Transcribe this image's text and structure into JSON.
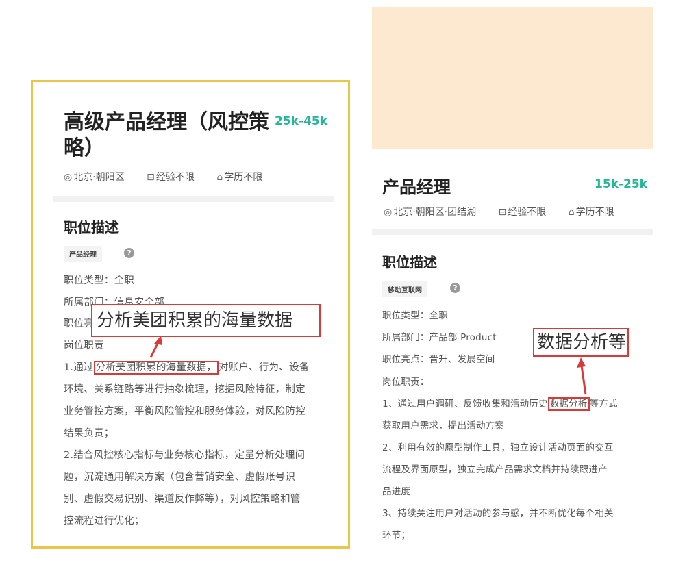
{
  "left": {
    "title": "高级产品经理（风控策略）",
    "salary": "25k-45k",
    "location": "北京·朝阳区",
    "experience": "经验不限",
    "education": "学历不限",
    "section_title": "职位描述",
    "tag": "产品经理",
    "help": "?",
    "lines": {
      "type": "职位类型：全职",
      "dept": "所属部门：信息安全部",
      "highlights_prefix": "职位亮",
      "duties": "岗位职责",
      "l1_a": "1.通过",
      "l1_hl": "分析美团积累的海量数据，",
      "l1_b": "对账户、行为、设备",
      "l2": "环境、关系链路等进行抽象梳理，挖掘风险特征，制定",
      "l3": "业务管控方案，平衡风险管控和服务体验，对风险防控",
      "l4": "结果负责；",
      "l5": "2.结合风控核心指标与业务核心指标，定量分析处理问",
      "l6": "题，沉淀通用解决方案（包含营销安全、虚假账号识",
      "l7": "别、虚假交易识别、渠道反作弊等），对风控策略和管",
      "l8": "控流程进行优化；"
    },
    "callout": "分析美团积累的海量数据"
  },
  "right": {
    "title": "产品经理",
    "salary": "15k-25k",
    "location": "北京·朝阳区·团结湖",
    "experience": "经验不限",
    "education": "学历不限",
    "section_title": "职位描述",
    "tag": "移动互联网",
    "help": "?",
    "lines": {
      "type": "职位类型：全职",
      "dept": "所属部门：产品部 Product",
      "highlights": "职位亮点：晋升、发展空间",
      "duties": "岗位职责：",
      "l1_a": "1、通过用户调研、反馈收集和活动历史",
      "l1_hl": "数据分析",
      "l1_b": "等方式",
      "l2": "获取用户需求，提出活动方案",
      "l3": "2、利用有效的原型制作工具，独立设计活动页面的交互",
      "l4": "流程及界面原型，独立完成产品需求文档并持续跟进产",
      "l5": "品进度",
      "l6": "3、持续关注用户对活动的参与感，并不断优化每个相关",
      "l7": "环节；"
    },
    "callout": "数据分析等"
  },
  "colors": {
    "accent_salary": "#27b69a",
    "highlight_border": "#d63a3a",
    "card_border": "#e8c64a",
    "banner": "#fde9cf"
  },
  "icons": {
    "location": "location-pin-icon",
    "experience": "briefcase-icon",
    "education": "graduation-cap-icon",
    "help": "help-circle-icon"
  }
}
